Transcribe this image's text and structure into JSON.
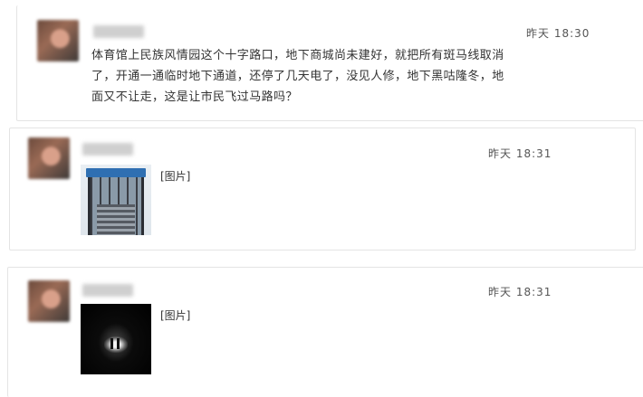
{
  "posts": [
    {
      "time": "昨天 18:30",
      "text_lines": [
        "体育馆上民族风情园这个十字路口，地下商城尚未建好，就把所有斑马线取消",
        "了，开通一通临时地下通道，还停了几天电了，没见人修，地下黑咕隆冬，地",
        "面又不让走，这是让市民飞过马路吗？"
      ]
    },
    {
      "time": "昨天 18:31",
      "image_label": "[图片]"
    },
    {
      "time": "昨天 18:31",
      "image_label": "[图片]"
    }
  ]
}
